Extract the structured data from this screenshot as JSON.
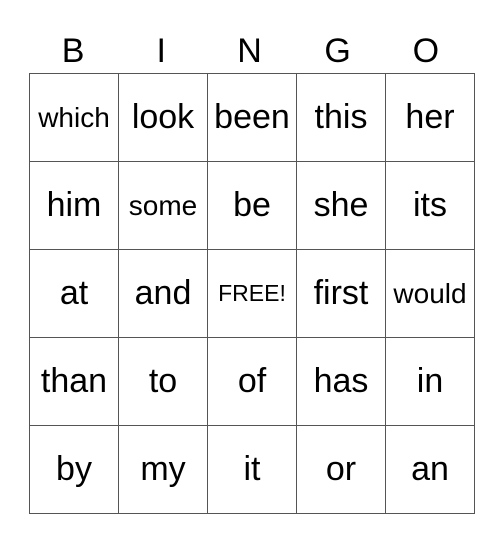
{
  "header": [
    "B",
    "I",
    "N",
    "G",
    "O"
  ],
  "grid": [
    [
      "which",
      "look",
      "been",
      "this",
      "her"
    ],
    [
      "him",
      "some",
      "be",
      "she",
      "its"
    ],
    [
      "at",
      "and",
      "FREE!",
      "first",
      "would"
    ],
    [
      "than",
      "to",
      "of",
      "has",
      "in"
    ],
    [
      "by",
      "my",
      "it",
      "or",
      "an"
    ]
  ]
}
